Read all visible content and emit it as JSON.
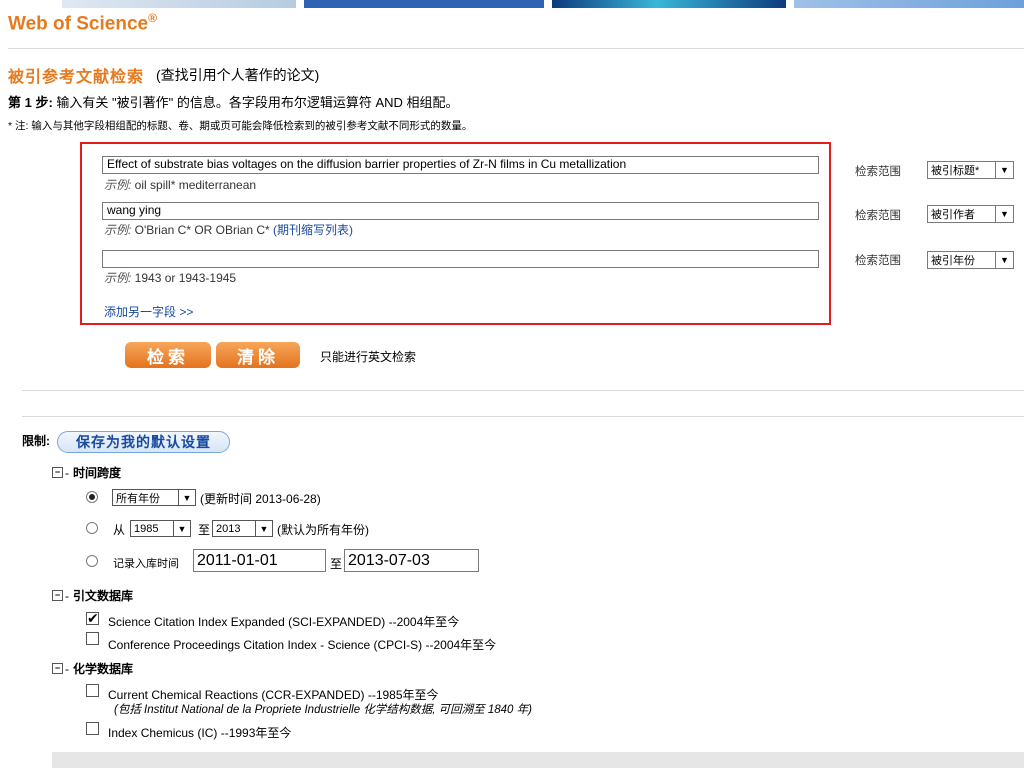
{
  "brand": {
    "name": "Web of Science",
    "mark": "®"
  },
  "page": {
    "title": "被引参考文献检索",
    "subtitle": "(查找引用个人著作的论文)",
    "step_label": "第 1 步:",
    "step_text": "输入有关 \"被引著作\" 的信息。各字段用布尔逻辑运算符 AND 相组配。",
    "note": "* 注: 输入与其他字段相组配的标题、卷、期或页可能会降低检索到的被引参考文献不同形式的数量。"
  },
  "fields": [
    {
      "value": "Effect of substrate bias voltages on the diffusion barrier properties of Zr-N films in Cu metallization",
      "example_prefix": "示例:",
      "example": " oil spill* mediterranean",
      "scope_label": "检索范围",
      "scope": "被引标题*"
    },
    {
      "value": "wang ying",
      "example_prefix": "示例:",
      "example": " O'Brian C* OR OBrian C* ",
      "example_link": "(期刊缩写列表)",
      "scope_label": "检索范围",
      "scope": "被引作者"
    },
    {
      "value": "",
      "example_prefix": "示例:",
      "example": " 1943 or 1943-1945",
      "scope_label": "检索范围",
      "scope": "被引年份"
    }
  ],
  "add_field": "添加另一字段 >>",
  "buttons": {
    "search": "检索",
    "clear": "清除",
    "english_only": "只能进行英文检索"
  },
  "limits": {
    "label": "限制:",
    "save_default": "保存为我的默认设置",
    "timespan": {
      "title": "时间跨度",
      "all_years": "所有年份",
      "updated": "(更新时间 2013-06-28)",
      "from": "从",
      "from_year": "1985",
      "to": "至",
      "to_year": "2013",
      "default_note": "(默认为所有年份)",
      "entry_label": "记录入库时间",
      "entry_from": "2011-01-01",
      "entry_to_label": "至",
      "entry_to": "2013-07-03"
    },
    "citation_db": {
      "title": "引文数据库",
      "items": [
        {
          "label": "Science Citation Index Expanded (SCI-EXPANDED) --2004年至今",
          "checked": true
        },
        {
          "label": "Conference Proceedings Citation Index - Science (CPCI-S) --2004年至今",
          "checked": false
        }
      ]
    },
    "chem_db": {
      "title": "化学数据库",
      "items": [
        {
          "label": "Current Chemical Reactions (CCR-EXPANDED) --1985年至今",
          "sub": "(包括 Institut National de la Propriete Industrielle 化学结构数据, 可回溯至 1840 年)",
          "checked": false
        },
        {
          "label": "Index Chemicus (IC) --1993年至今",
          "checked": false
        }
      ]
    }
  }
}
